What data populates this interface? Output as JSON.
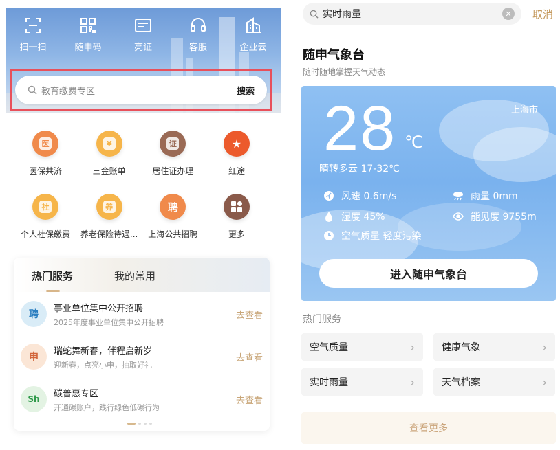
{
  "left": {
    "quick_actions": [
      {
        "label": "扫一扫",
        "icon": "scan-icon"
      },
      {
        "label": "随申码",
        "icon": "qr-code-icon"
      },
      {
        "label": "亮证",
        "icon": "id-card-icon"
      },
      {
        "label": "客服",
        "icon": "headset-icon"
      },
      {
        "label": "企业云",
        "icon": "building-icon"
      }
    ],
    "search": {
      "placeholder": "教育缴费专区",
      "button": "搜索"
    },
    "grid": [
      {
        "label": "医保共济",
        "icon": "medical-insurance-icon",
        "color": "#f08a4b"
      },
      {
        "label": "三金账单",
        "icon": "fund-bill-icon",
        "color": "#f6b54a"
      },
      {
        "label": "居住证办理",
        "icon": "residence-permit-icon",
        "color": "#9a6a55"
      },
      {
        "label": "红途",
        "icon": "red-star-icon",
        "color": "#ec5a2c"
      },
      {
        "label": "个人社保缴费",
        "icon": "social-security-icon",
        "color": "#f6b54a"
      },
      {
        "label": "养老保险待遇...",
        "icon": "pension-icon",
        "color": "#f6b54a"
      },
      {
        "label": "上海公共招聘",
        "icon": "recruitment-icon",
        "color": "#f08a4b"
      },
      {
        "label": "更多",
        "icon": "more-apps-icon",
        "color": "#8a5a4a"
      }
    ],
    "tabs": {
      "hot": "热门服务",
      "mine": "我的常用"
    },
    "services": [
      {
        "title": "事业单位集中公开招聘",
        "subtitle": "2025年度事业单位集中公开招聘",
        "action": "去查看",
        "logo": "聘"
      },
      {
        "title": "瑞蛇舞新春，伴程启新岁",
        "subtitle": "迎新春，点亮小申，抽取好礼",
        "action": "去查看",
        "logo": "申"
      },
      {
        "title": "碳普惠专区",
        "subtitle": "开通碳账户，践行绿色低碳行为",
        "action": "去查看",
        "logo": "Sh"
      }
    ]
  },
  "right": {
    "search_value": "实时雨量",
    "cancel": "取消",
    "title": "随申气象台",
    "subtitle": "随时随地掌握天气动态",
    "weather": {
      "temp": "28",
      "unit": "℃",
      "city": "上海市",
      "condition": "晴转多云 17-32℃",
      "wind": "风速 0.6m/s",
      "rain": "雨量 0mm",
      "humidity": "湿度 45%",
      "visibility": "能见度 9755m",
      "air": "空气质量 轻度污染"
    },
    "enter_button": "进入随申气象台",
    "hot_title": "热门服务",
    "tiles": [
      "空气质量",
      "健康气象",
      "实时雨量",
      "天气档案"
    ],
    "more": "查看更多"
  }
}
